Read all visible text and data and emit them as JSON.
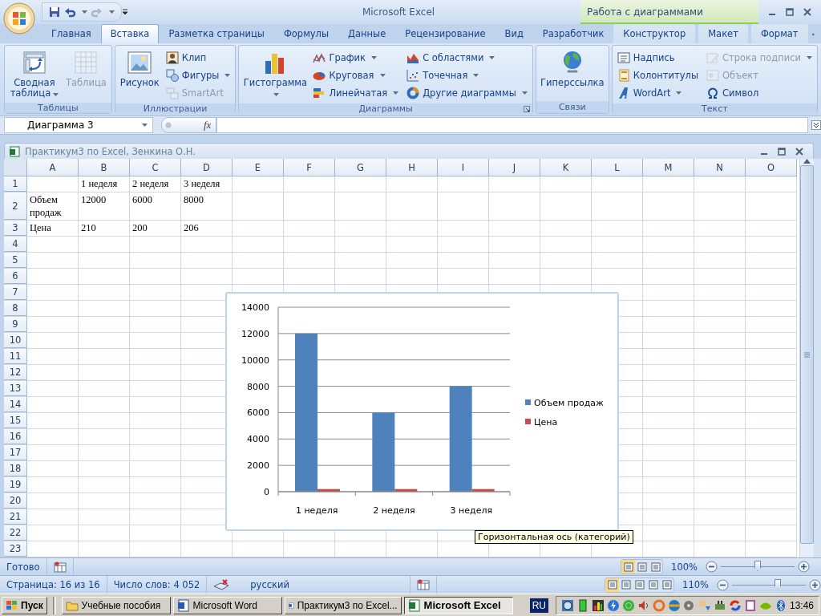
{
  "window": {
    "title": "Microsoft Excel",
    "context_title": "Работа с диаграммами"
  },
  "tabs": [
    {
      "label": "Главная",
      "selected": false,
      "kind": "main"
    },
    {
      "label": "Вставка",
      "selected": true,
      "kind": "main"
    },
    {
      "label": "Разметка страницы",
      "selected": false,
      "kind": "main"
    },
    {
      "label": "Формулы",
      "selected": false,
      "kind": "main"
    },
    {
      "label": "Данные",
      "selected": false,
      "kind": "main"
    },
    {
      "label": "Рецензирование",
      "selected": false,
      "kind": "main"
    },
    {
      "label": "Вид",
      "selected": false,
      "kind": "main"
    },
    {
      "label": "Разработчик",
      "selected": false,
      "kind": "main"
    },
    {
      "label": "Конструктор",
      "selected": false,
      "kind": "context"
    },
    {
      "label": "Макет",
      "selected": false,
      "kind": "context"
    },
    {
      "label": "Формат",
      "selected": false,
      "kind": "context"
    }
  ],
  "ribbon": [
    {
      "label": "Таблицы",
      "launcher": false,
      "items": [
        {
          "kind": "large",
          "label": "Сводная таблица",
          "dropdown": true,
          "disabled": false
        },
        {
          "kind": "large",
          "label": "Таблица",
          "dropdown": false,
          "disabled": true
        }
      ]
    },
    {
      "label": "Иллюстрации",
      "launcher": false,
      "items": [
        {
          "kind": "large",
          "label": "Рисунок",
          "dropdown": false,
          "disabled": false
        },
        {
          "kind": "small",
          "label": "Клип",
          "dropdown": false,
          "disabled": false
        },
        {
          "kind": "small",
          "label": "Фигуры",
          "dropdown": true,
          "disabled": false
        },
        {
          "kind": "small",
          "label": "SmartArt",
          "dropdown": false,
          "disabled": true
        }
      ]
    },
    {
      "label": "Диаграммы",
      "launcher": true,
      "items": [
        {
          "kind": "large",
          "label": "Гистограмма",
          "dropdown": true,
          "disabled": false
        },
        {
          "kind": "small",
          "label": "График",
          "dropdown": true,
          "disabled": false
        },
        {
          "kind": "small",
          "label": "Круговая",
          "dropdown": true,
          "disabled": false
        },
        {
          "kind": "small",
          "label": "Линейчатая",
          "dropdown": true,
          "disabled": false
        },
        {
          "kind": "small",
          "label": "С областями",
          "dropdown": true,
          "disabled": false
        },
        {
          "kind": "small",
          "label": "Точечная",
          "dropdown": true,
          "disabled": false
        },
        {
          "kind": "small",
          "label": "Другие диаграммы",
          "dropdown": true,
          "disabled": false
        }
      ]
    },
    {
      "label": "Связи",
      "launcher": false,
      "items": [
        {
          "kind": "large",
          "label": "Гиперссылка",
          "dropdown": false,
          "disabled": false
        }
      ]
    },
    {
      "label": "Текст",
      "launcher": false,
      "items": [
        {
          "kind": "small",
          "label": "Надпись",
          "dropdown": false,
          "disabled": false
        },
        {
          "kind": "small",
          "label": "Колонтитулы",
          "dropdown": false,
          "disabled": false
        },
        {
          "kind": "small",
          "label": "WordArt",
          "dropdown": true,
          "disabled": false
        },
        {
          "kind": "small",
          "label": "Строка подписи",
          "dropdown": true,
          "disabled": true
        },
        {
          "kind": "small",
          "label": "Объект",
          "dropdown": false,
          "disabled": true
        },
        {
          "kind": "small",
          "label": "Символ",
          "dropdown": false,
          "disabled": false
        }
      ]
    }
  ],
  "formula_bar": {
    "name_box": "Диаграмма 3",
    "function_button": "fx"
  },
  "workbook": {
    "title": "Практикум3 по Excel, Зенкина О.Н."
  },
  "sheet": {
    "columns": [
      "A",
      "B",
      "C",
      "D",
      "E",
      "F",
      "G",
      "H",
      "I",
      "J",
      "K",
      "L",
      "M",
      "N",
      "O"
    ],
    "rows": [
      {
        "number": "1",
        "cells": [
          null,
          "1 неделя",
          "2 неделя",
          "3 неделя"
        ]
      },
      {
        "number": "2",
        "cells": [
          "Объем продаж",
          "12000",
          "6000",
          "8000"
        ]
      },
      {
        "number": "3",
        "cells": [
          "Цена",
          "210",
          "200",
          "206"
        ]
      },
      {
        "number": "4"
      },
      {
        "number": "5"
      },
      {
        "number": "6"
      },
      {
        "number": "7"
      },
      {
        "number": "8"
      },
      {
        "number": "9"
      },
      {
        "number": "10"
      },
      {
        "number": "11"
      },
      {
        "number": "12"
      },
      {
        "number": "13"
      },
      {
        "number": "14"
      },
      {
        "number": "15"
      },
      {
        "number": "16"
      },
      {
        "number": "17"
      },
      {
        "number": "18"
      },
      {
        "number": "19"
      },
      {
        "number": "20"
      },
      {
        "number": "21"
      },
      {
        "number": "22"
      },
      {
        "number": "23"
      }
    ]
  },
  "chart": {
    "tooltip": "Горизонтальная ось (категорий)",
    "chart_data": {
      "type": "bar",
      "categories": [
        "1 неделя",
        "2 неделя",
        "3 неделя"
      ],
      "series": [
        {
          "name": "Объем продаж",
          "color": "#4f81bd",
          "values": [
            12000,
            6000,
            8000
          ]
        },
        {
          "name": "Цена",
          "color": "#c0504d",
          "values": [
            200,
            200,
            200
          ]
        }
      ],
      "grid": true,
      "legend": true,
      "ylim": [
        0,
        14000
      ],
      "yticks": [
        0,
        2000,
        4000,
        6000,
        8000,
        10000,
        12000,
        14000
      ]
    }
  },
  "excel_status": {
    "text": "Готово",
    "views": [
      {
        "selected": true
      },
      {
        "selected": false
      },
      {
        "selected": false
      }
    ],
    "zoom": "100%",
    "zoom_slider": {
      "level": 0.5
    }
  },
  "word_status": {
    "page": "Страница: 16 из 16",
    "words": "Число слов: 4 052",
    "language": "русский",
    "views": [
      {
        "selected": true
      },
      {
        "selected": false
      },
      {
        "selected": false
      },
      {
        "selected": false
      },
      {
        "selected": false
      }
    ],
    "zoom": "110%",
    "zoom_slider": {
      "level": 0.62
    }
  },
  "taskbar": {
    "start": "Пуск",
    "tasks": [
      {
        "label": "Учебные пособия",
        "selected": false
      },
      {
        "label": "Microsoft Word",
        "selected": false
      },
      {
        "label": "Практикум3 по Excel...",
        "selected": false
      },
      {
        "label": "Microsoft Excel",
        "selected": true
      }
    ],
    "language": "RU",
    "clock": "13:46"
  }
}
